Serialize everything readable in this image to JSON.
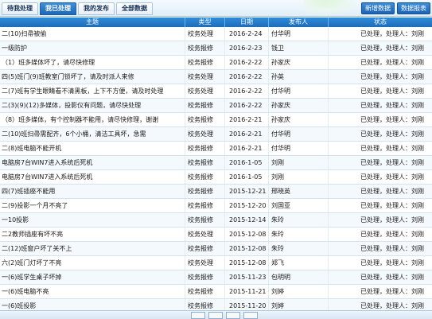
{
  "tabs": [
    "待我处理",
    "我已处理",
    "我的发布",
    "全部数据"
  ],
  "active_tab": 1,
  "toolbar": {
    "new_button": "新增数据",
    "export_button": "数据报表"
  },
  "columns": [
    "主题",
    "类型",
    "日期",
    "发布人",
    "状态"
  ],
  "rows": [
    [
      "二(10)扫帚被偷",
      "校务处理",
      "2016-2-24",
      "付华明",
      "已处理，处理人：刘刚"
    ],
    [
      "一级防护",
      "校务报修",
      "2016-2-23",
      "钱卫",
      "已处理，处理人：刘刚"
    ],
    [
      "（1）班多媒体坏了，请尽快修理",
      "校务报修",
      "2016-2-22",
      "孙家庆",
      "已处理，处理人：刘刚"
    ],
    [
      "四(5)班门(9)班教室门锁坏了，请及时派人来修",
      "校务处理",
      "2016-2-22",
      "孙英",
      "已处理，处理人：刘刚"
    ],
    [
      "二(7)班有学生眼睛看不清黑板，上下不方便，请及时处理",
      "校务处理",
      "2016-2-22",
      "付华明",
      "已处理，处理人：刘刚"
    ],
    [
      "二(3)(9)(12)多媒体，投影仪有问题，请尽快处理",
      "校务报修",
      "2016-2-22",
      "孙家庆",
      "已处理，处理人：刘刚"
    ],
    [
      "（8）班多媒体，有个控制器不能用，请尽快修理，谢谢",
      "校务报修",
      "2016-2-21",
      "孙家庆",
      "已处理，处理人：刘刚"
    ],
    [
      "二(10)班扫帚需配齐，6个小桶，清洁工具坏，急需",
      "校务处理",
      "2016-2-21",
      "付华明",
      "已处理，处理人：刘刚"
    ],
    [
      "二(8)班电脑不能开机",
      "校务报修",
      "2016-2-21",
      "付华明",
      "已处理，处理人：刘刚"
    ],
    [
      "电脑房7台WIN7进入系统后死机",
      "校务报修",
      "2016-1-05",
      "刘刚",
      "已处理，处理人：刘刚"
    ],
    [
      "电脑房7台WIN7进入系统后死机",
      "校务报修",
      "2016-1-05",
      "刘刚",
      "已处理，处理人：刘刚"
    ],
    [
      "四(7)班插座不能用",
      "校务报修",
      "2015-12-21",
      "邢晓英",
      "已处理，处理人：刘刚"
    ],
    [
      "二(9)投影一个月不亮了",
      "校务报修",
      "2015-12-20",
      "刘国亚",
      "已处理，处理人：刘刚"
    ],
    [
      "一10投影",
      "校务报修",
      "2015-12-14",
      "朱玲",
      "已处理，处理人：刘刚"
    ],
    [
      "二2教师插座有坏不亮",
      "校务处理",
      "2015-12-08",
      "朱玲",
      "已处理，处理人：刘刚"
    ],
    [
      "二(12)班窗户坏了关不上",
      "校务报修",
      "2015-12-08",
      "朱玲",
      "已处理，处理人：刘刚"
    ],
    [
      "六(2)班门灯坏了不亮",
      "校务处理",
      "2015-12-08",
      "郑飞",
      "已处理，处理人：刘刚"
    ],
    [
      "一(6)班学生桌子坏掉",
      "校务报修",
      "2015-11-23",
      "包明明",
      "已处理，处理人：刘刚"
    ],
    [
      "一(6)班电脑不亮",
      "校务报修",
      "2015-11-21",
      "刘婷",
      "已处理，处理人：刘刚"
    ],
    [
      "一(6)班投影",
      "校务报修",
      "2015-11-20",
      "刘婷",
      "已处理，处理人：刘刚"
    ]
  ]
}
